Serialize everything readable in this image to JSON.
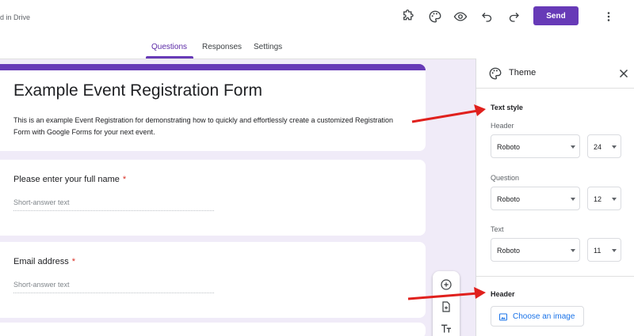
{
  "header": {
    "saved_status": "d in Drive",
    "send_label": "Send",
    "icons": [
      "add-ons-icon",
      "palette-icon",
      "preview-eye-icon",
      "undo-icon",
      "redo-icon"
    ]
  },
  "tabs": [
    {
      "label": "Questions",
      "active": true
    },
    {
      "label": "Responses",
      "active": false
    },
    {
      "label": "Settings",
      "active": false
    }
  ],
  "form": {
    "title": "Example Event Registration Form",
    "description": "This is an example Event Registration for demonstrating how to quickly and effortlessly create a customized Registration Form with Google Forms for your next event."
  },
  "questions": [
    {
      "label": "Please enter your full name",
      "required": "*",
      "placeholder": "Short-answer text"
    },
    {
      "label": "Email address",
      "required": "*",
      "placeholder": "Short-answer text"
    }
  ],
  "theme_panel": {
    "title": "Theme",
    "text_style_heading": "Text style",
    "header_label": "Header",
    "header_font": "Roboto",
    "header_size": "24",
    "question_label": "Question",
    "question_font": "Roboto",
    "question_size": "12",
    "text_label": "Text",
    "text_font": "Roboto",
    "text_size": "11",
    "header_section_heading": "Header",
    "choose_image_label": "Choose an image"
  },
  "colors": {
    "accent": "#673ab7",
    "canvas_bg": "#f0ebf8",
    "annotation_arrow": "#e0201d",
    "link": "#1a73e8"
  }
}
